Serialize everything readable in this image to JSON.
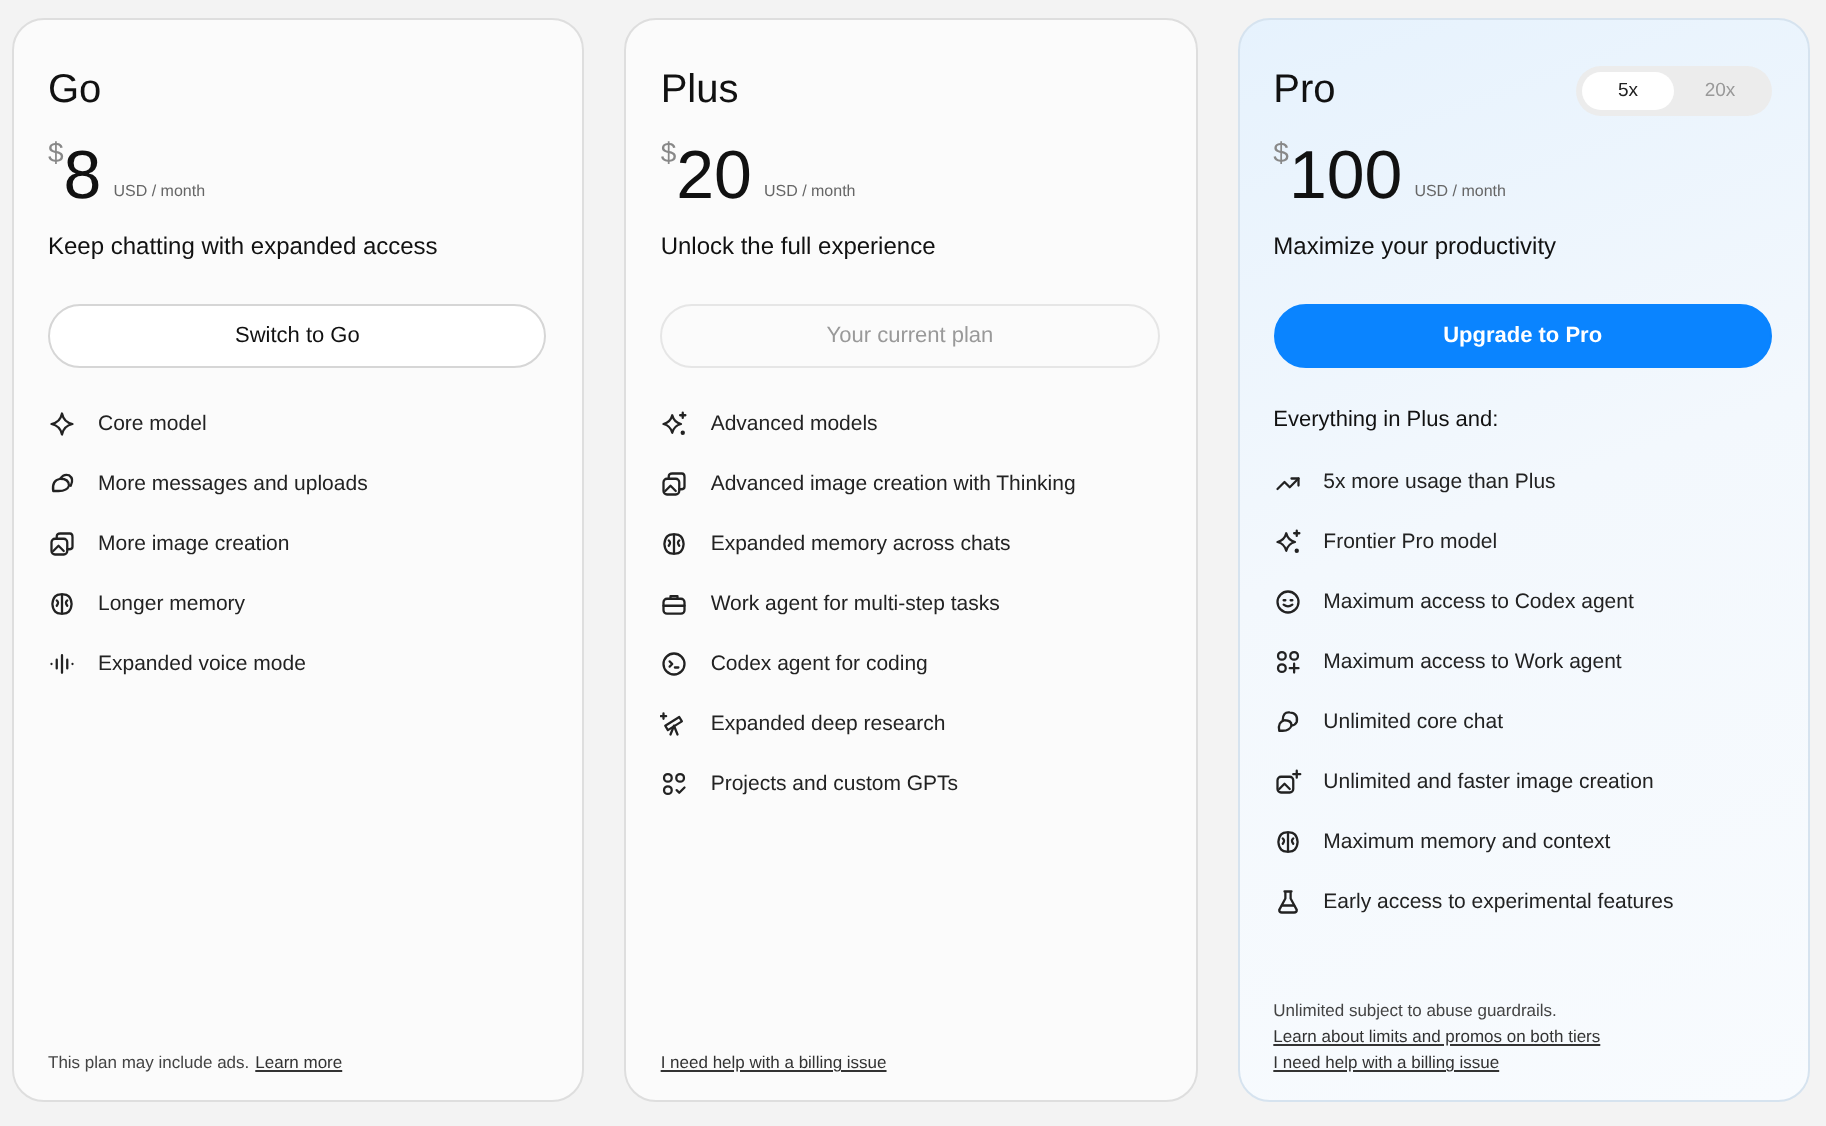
{
  "plans": [
    {
      "name": "Go",
      "currency": "$",
      "price": "8",
      "period": "USD / month",
      "tagline": "Keep chatting with expanded access",
      "highlighted": false,
      "button": {
        "label": "Switch to Go",
        "kind": "outline"
      },
      "features": [
        {
          "text": "Core model"
        },
        {
          "text": "More messages and uploads"
        },
        {
          "text": "More image creation"
        },
        {
          "text": "Longer memory"
        },
        {
          "text": "Expanded voice mode"
        }
      ],
      "footer": [
        [
          {
            "kind": "note",
            "text": "This plan may include ads."
          },
          {
            "kind": "link",
            "text": "Learn more"
          }
        ]
      ]
    },
    {
      "name": "Plus",
      "currency": "$",
      "price": "20",
      "period": "USD / month",
      "tagline": "Unlock the full experience",
      "highlighted": false,
      "button": {
        "label": "Your current plan",
        "kind": "disabled"
      },
      "features": [
        {
          "text": "Advanced models"
        },
        {
          "text": "Advanced image creation with Thinking"
        },
        {
          "text": "Expanded memory across chats"
        },
        {
          "text": "Work agent for multi-step tasks"
        },
        {
          "text": "Codex agent for coding"
        },
        {
          "text": "Expanded deep research"
        },
        {
          "text": "Projects and custom GPTs"
        }
      ],
      "footer": [
        [
          {
            "kind": "link",
            "text": "I need help with a billing issue"
          }
        ]
      ]
    },
    {
      "name": "Pro",
      "currency": "$",
      "price": "100",
      "period": "USD / month",
      "tagline": "Maximize your productivity",
      "highlighted": true,
      "tiers": [
        {
          "label": "5x",
          "selected": true
        },
        {
          "label": "20x",
          "selected": false
        }
      ],
      "button": {
        "label": "Upgrade to Pro",
        "kind": "primary"
      },
      "intro": "Everything in Plus and:",
      "features": [
        {
          "text": "5x more usage than Plus"
        },
        {
          "text": "Frontier Pro model"
        },
        {
          "text": "Maximum access to Codex agent"
        },
        {
          "text": "Maximum access to Work agent"
        },
        {
          "text": "Unlimited core chat"
        },
        {
          "text": "Unlimited and faster image creation"
        },
        {
          "text": "Maximum memory and context"
        },
        {
          "text": "Early access to experimental features"
        }
      ],
      "footer": [
        [
          {
            "kind": "note",
            "text": "Unlimited subject to abuse guardrails."
          }
        ],
        [
          {
            "kind": "link",
            "text": "Learn about limits and promos on both tiers"
          }
        ],
        [
          {
            "kind": "link",
            "text": "I need help with a billing issue"
          }
        ]
      ]
    }
  ]
}
